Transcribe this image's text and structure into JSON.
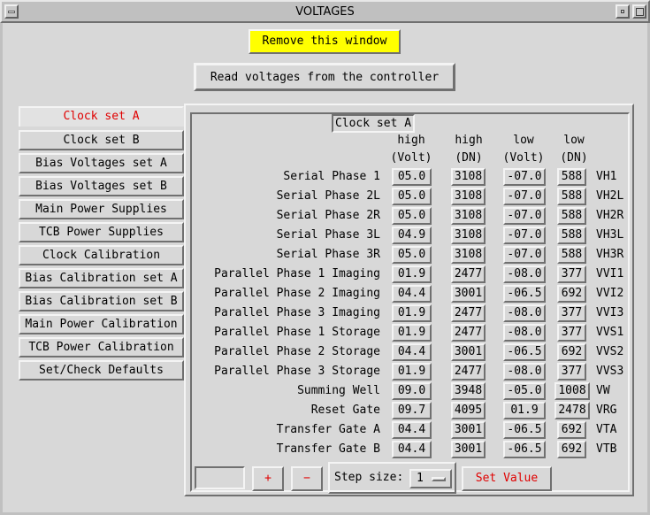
{
  "window": {
    "title": "VOLTAGES"
  },
  "buttons": {
    "remove": "Remove this window",
    "read": "Read voltages from the controller",
    "plus": "+",
    "minus": "−",
    "set_value": "Set Value"
  },
  "tabs": [
    {
      "label": "Clock set A",
      "active": true
    },
    {
      "label": "Clock set B"
    },
    {
      "label": "Bias Voltages set A"
    },
    {
      "label": "Bias Voltages set B"
    },
    {
      "label": "Main Power Supplies"
    },
    {
      "label": "TCB Power Supplies"
    },
    {
      "label": "Clock Calibration"
    },
    {
      "label": "Bias Calibration set A"
    },
    {
      "label": "Bias Calibration set B"
    },
    {
      "label": "Main Power Calibration"
    },
    {
      "label": "TCB Power Calibration"
    },
    {
      "label": "Set/Check Defaults"
    }
  ],
  "panel": {
    "title": "Clock set A",
    "headers": [
      {
        "line1": "high",
        "line2": "(Volt)"
      },
      {
        "line1": "high",
        "line2": "(DN)"
      },
      {
        "line1": "low",
        "line2": "(Volt)"
      },
      {
        "line1": "low",
        "line2": "(DN)"
      }
    ],
    "rows": [
      {
        "label": "Serial Phase 1",
        "high_v": "05.0",
        "high_dn": "3108",
        "low_v": "-07.0",
        "low_dn": "588",
        "code": "VH1"
      },
      {
        "label": "Serial Phase 2L",
        "high_v": "05.0",
        "high_dn": "3108",
        "low_v": "-07.0",
        "low_dn": "588",
        "code": "VH2L"
      },
      {
        "label": "Serial Phase 2R",
        "high_v": "05.0",
        "high_dn": "3108",
        "low_v": "-07.0",
        "low_dn": "588",
        "code": "VH2R"
      },
      {
        "label": "Serial Phase 3L",
        "high_v": "04.9",
        "high_dn": "3108",
        "low_v": "-07.0",
        "low_dn": "588",
        "code": "VH3L"
      },
      {
        "label": "Serial Phase 3R",
        "high_v": "05.0",
        "high_dn": "3108",
        "low_v": "-07.0",
        "low_dn": "588",
        "code": "VH3R"
      },
      {
        "label": "Parallel Phase 1 Imaging",
        "high_v": "01.9",
        "high_dn": "2477",
        "low_v": "-08.0",
        "low_dn": "377",
        "code": "VVI1"
      },
      {
        "label": "Parallel Phase 2 Imaging",
        "high_v": "04.4",
        "high_dn": "3001",
        "low_v": "-06.5",
        "low_dn": "692",
        "code": "VVI2"
      },
      {
        "label": "Parallel Phase 3 Imaging",
        "high_v": "01.9",
        "high_dn": "2477",
        "low_v": "-08.0",
        "low_dn": "377",
        "code": "VVI3"
      },
      {
        "label": "Parallel Phase 1 Storage",
        "high_v": "01.9",
        "high_dn": "2477",
        "low_v": "-08.0",
        "low_dn": "377",
        "code": "VVS1"
      },
      {
        "label": "Parallel Phase 2 Storage",
        "high_v": "04.4",
        "high_dn": "3001",
        "low_v": "-06.5",
        "low_dn": "692",
        "code": "VVS2"
      },
      {
        "label": "Parallel Phase 3 Storage",
        "high_v": "01.9",
        "high_dn": "2477",
        "low_v": "-08.0",
        "low_dn": "377",
        "code": "VVS3"
      },
      {
        "label": "Summing Well",
        "high_v": "09.0",
        "high_dn": "3948",
        "low_v": "-05.0",
        "low_dn": "1008",
        "code": "VW"
      },
      {
        "label": "Reset Gate",
        "high_v": "09.7",
        "high_dn": "4095",
        "low_v": "01.9",
        "low_dn": "2478",
        "code": "VRG"
      },
      {
        "label": "Transfer Gate A",
        "high_v": "04.4",
        "high_dn": "3001",
        "low_v": "-06.5",
        "low_dn": "692",
        "code": "VTA"
      },
      {
        "label": "Transfer Gate B",
        "high_v": "04.4",
        "high_dn": "3001",
        "low_v": "-06.5",
        "low_dn": "692",
        "code": "VTB"
      }
    ]
  },
  "controls": {
    "value_input": "",
    "step_label": "Step size:",
    "step_value": "1"
  },
  "colors": {
    "background": "#d8d8d8",
    "remove_button": "#ffff00",
    "active_tab_text": "#e00000"
  }
}
